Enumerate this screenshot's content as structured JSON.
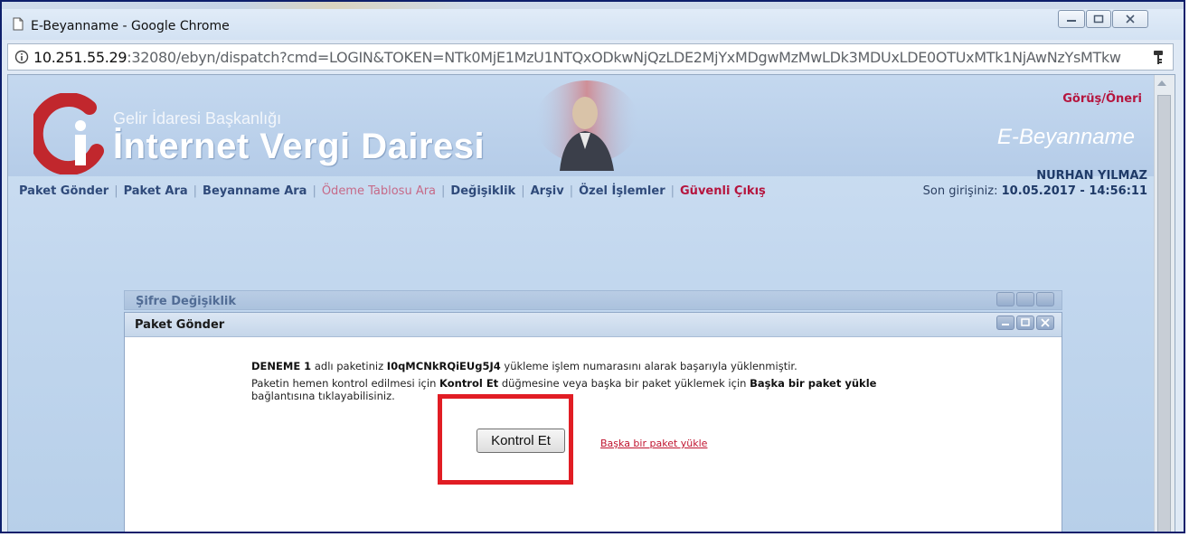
{
  "window": {
    "title": "E-Beyanname - Google Chrome",
    "url_host": "10.251.55.29",
    "url_rest": ":32080/ebyn/dispatch?cmd=LOGIN&TOKEN=NTk0MjE1MzU1NTQxODkwNjQzLDE2MjYxMDgwMzMwLDk3MDUxLDE0OTUxMTk1NjAwNzYsMTkw"
  },
  "header": {
    "agency_name": "Gelir İdaresi Başkanlığı",
    "site_name": "İnternet Vergi Dairesi",
    "product_name": "E-Beyanname",
    "feedback_link": "Görüş/Öneri",
    "user_name": "NURHAN YILMAZ",
    "last_login_label": "Son girişiniz:",
    "last_login_value": "10.05.2017 - 14:56:11"
  },
  "nav": {
    "items": [
      {
        "label": "Paket Gönder"
      },
      {
        "label": "Paket Ara"
      },
      {
        "label": "Beyanname Ara"
      },
      {
        "label": "Ödeme Tablosu Ara"
      },
      {
        "label": "Değişiklik"
      },
      {
        "label": "Arşiv"
      },
      {
        "label": "Özel İşlemler"
      },
      {
        "label": "Güvenli Çıkış"
      }
    ]
  },
  "background_dialog": {
    "title": "Şifre Değişiklik"
  },
  "dialog": {
    "title": "Paket Gönder",
    "package_name": "DENEME 1",
    "text_1": " adlı paketiniz ",
    "tracking_number": "I0qMCNkRQiEUg5J4",
    "text_2": " yükleme işlem numarasını alarak başarıyla yüklenmiştir.",
    "text_3": "Paketin hemen kontrol edilmesi için ",
    "bold_kontrol": "Kontrol Et",
    "text_4": " düğmesine veya başka bir paket yüklemek için ",
    "bold_baska": "Başka bir paket yükle",
    "text_5": " bağlantısına tıklayabilisiniz.",
    "kontrol_button": "Kontrol Et",
    "other_link": "Başka bir paket yükle"
  },
  "colors": {
    "highlight": "#e11d24",
    "nav_text": "#2f4a7a",
    "exit_text": "#b5153e"
  }
}
